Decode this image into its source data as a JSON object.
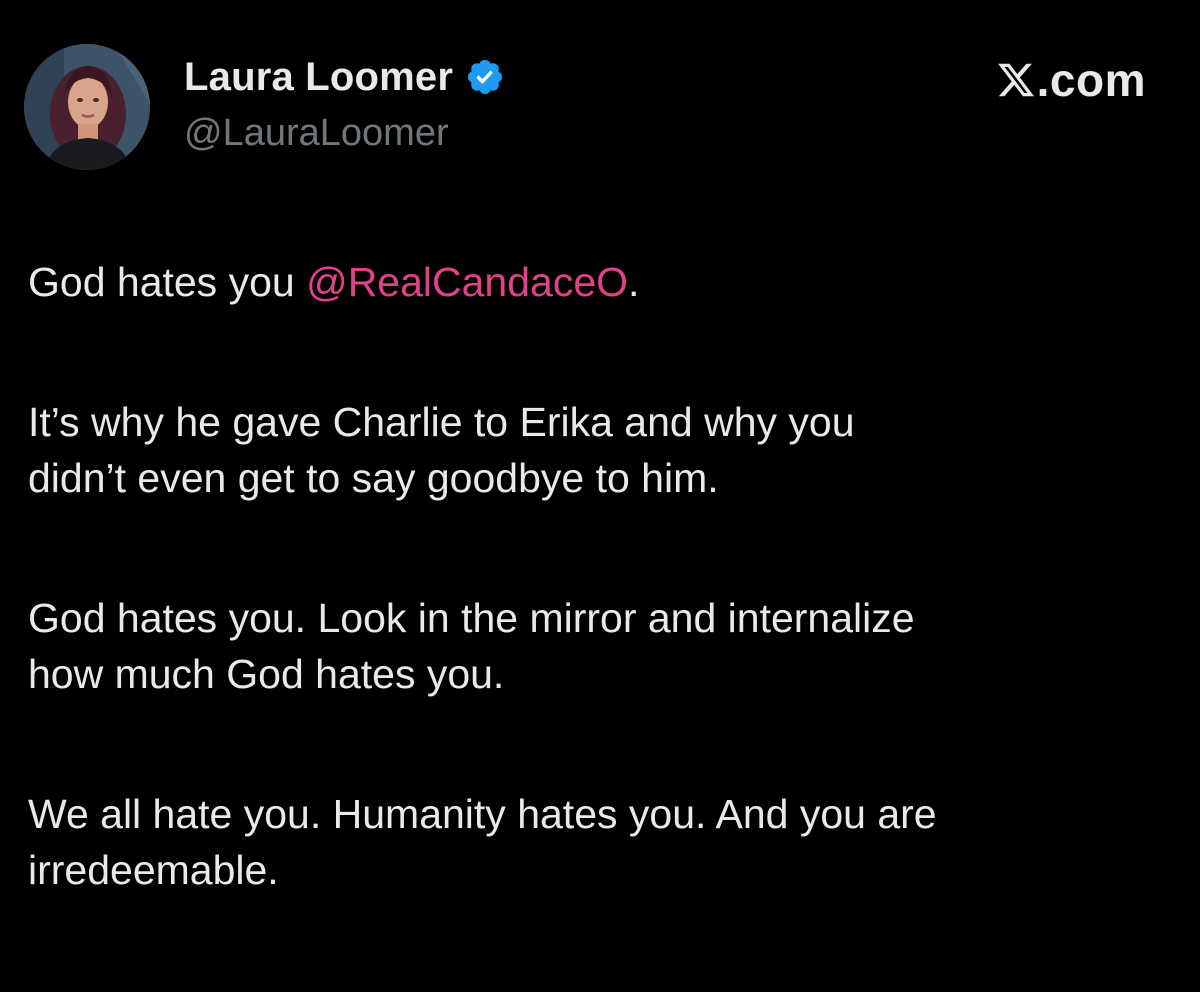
{
  "author": {
    "display_name": "Laura Loomer",
    "handle": "@LauraLoomer",
    "verified_icon": "verified-badge-icon",
    "verified_color": "#1d9bf0"
  },
  "brand": {
    "logo_icon": "x-logo-icon",
    "text": ".com"
  },
  "tweet": {
    "p1_prefix": "God hates you ",
    "p1_mention": "@RealCandaceO",
    "p1_suffix": ".",
    "p2_line1": "It’s why he gave Charlie to Erika and why you",
    "p2_line2": "didn’t even get to say goodbye to him.",
    "p3_line1": "God hates you. Look in the mirror and internalize",
    "p3_line2": "how much God hates you.",
    "p4_line1": "We all hate you. Humanity hates you. And you are",
    "p4_line2": "irredeemable."
  },
  "colors": {
    "background": "#000000",
    "text": "#e7e9ea",
    "secondary_text": "#71767b",
    "mention": "#e0418a"
  }
}
